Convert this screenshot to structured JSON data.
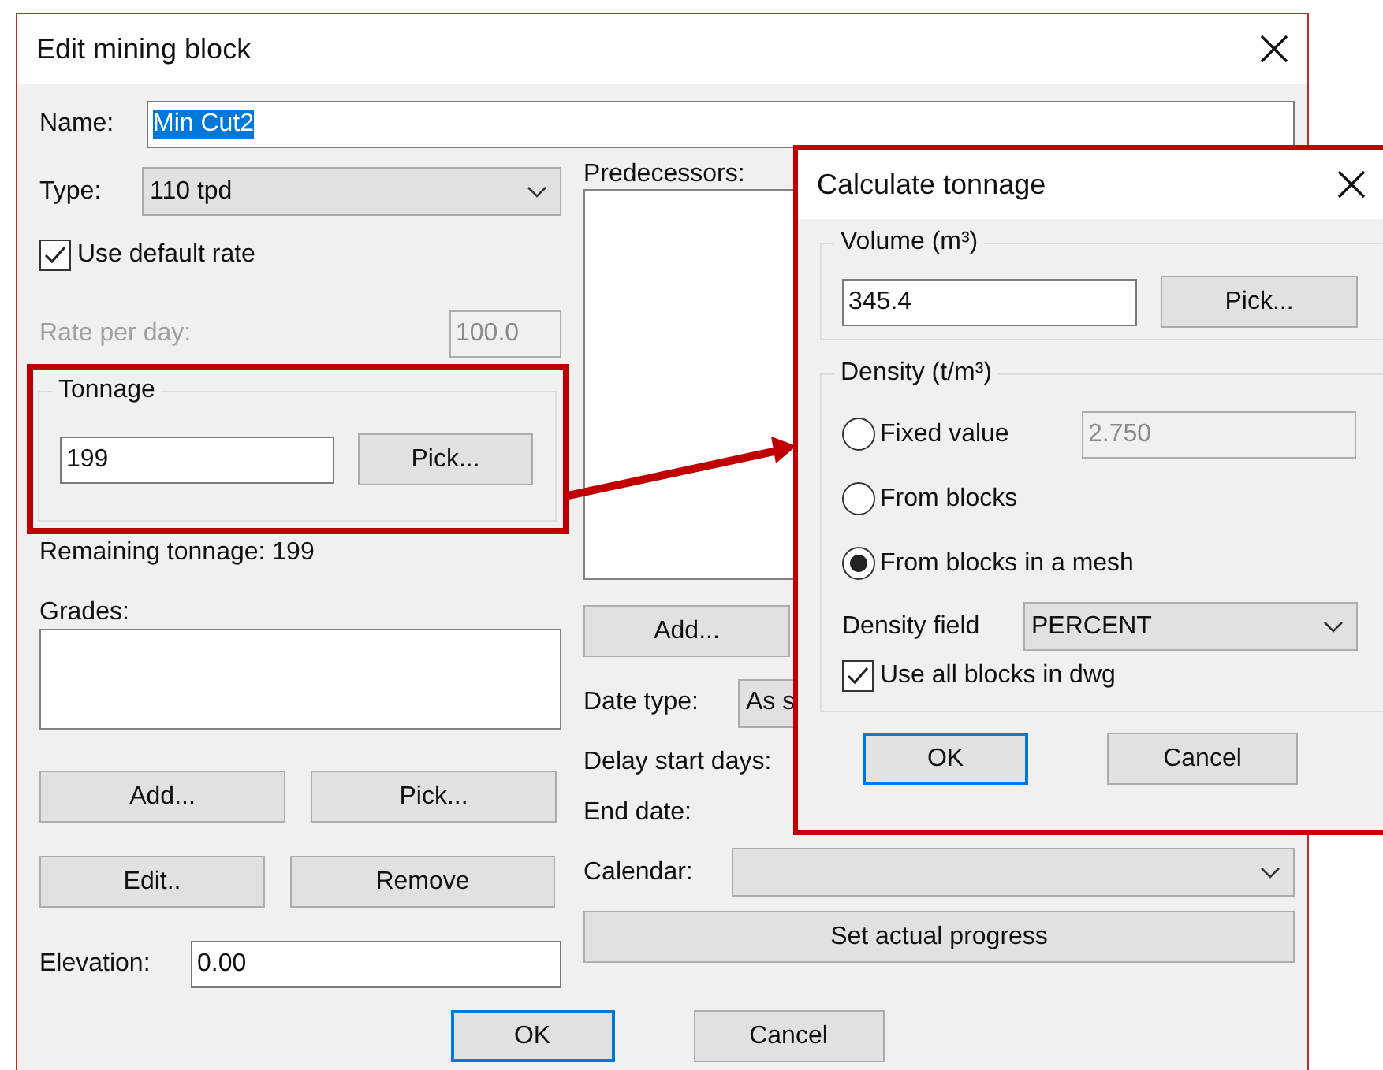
{
  "main_dialog": {
    "title": "Edit mining block",
    "name": {
      "label": "Name:",
      "value": "Min Cut2",
      "highlighted": true
    },
    "type": {
      "label": "Type:",
      "value": "110 tpd"
    },
    "use_default_rate": {
      "label": "Use default rate",
      "checked": true
    },
    "rate_per_day": {
      "label": "Rate per day:",
      "value": "100.0",
      "disabled": true
    },
    "tonnage": {
      "title": "Tonnage",
      "value": "199",
      "button": "Pick..."
    },
    "remaining_tonnage": "Remaining tonnage: 199",
    "grades": {
      "label": "Grades:",
      "buttons": [
        "Add...",
        "Pick...",
        "Edit..",
        "Remove"
      ]
    },
    "elevation": {
      "label": "Elevation:",
      "value": "0.00"
    },
    "predecessors": {
      "label": "Predecessors:",
      "button": "Add..."
    },
    "date_type": {
      "label": "Date type:",
      "value": "As s"
    },
    "delay_start_days": "Delay start days:",
    "end_date": "End date:",
    "calendar": {
      "label": "Calendar:"
    },
    "set_actual_progress": "Set actual progress",
    "buttons": [
      {
        "label": "OK",
        "focused": true
      },
      {
        "label": "Cancel",
        "focused": false
      }
    ]
  },
  "popup": {
    "title": "Calculate tonnage",
    "volume": {
      "title": "Volume (m³)",
      "value": "345.4",
      "button": "Pick..."
    },
    "density": {
      "title": "Density (t/m³)",
      "options": [
        {
          "label": "Fixed value",
          "selected": false
        },
        {
          "label": "From blocks",
          "selected": false
        },
        {
          "label": "From blocks in a mesh",
          "selected": true
        }
      ],
      "fixed_value": {
        "value": "2.750",
        "disabled": true
      },
      "density_field": {
        "label": "Density field",
        "value": "PERCENT"
      },
      "use_all_blocks": {
        "label": "Use all blocks in dwg",
        "checked": true
      }
    },
    "buttons": [
      {
        "label": "OK",
        "focused": true
      },
      {
        "label": "Cancel",
        "focused": false
      }
    ]
  }
}
